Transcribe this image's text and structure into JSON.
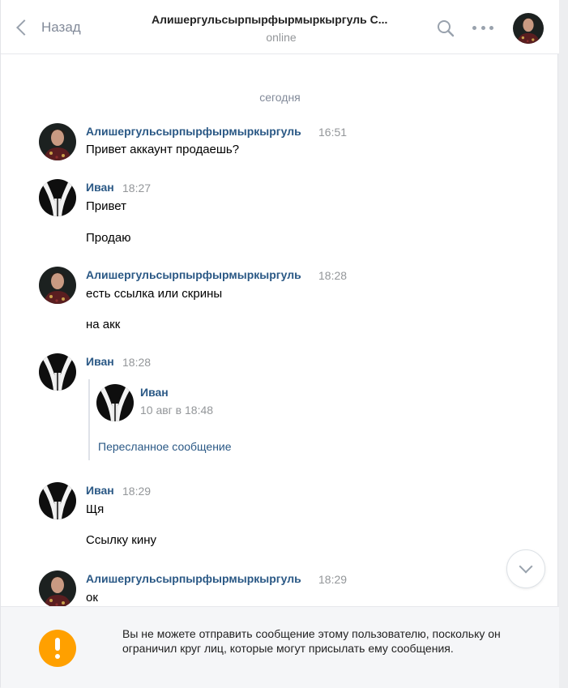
{
  "header": {
    "back_label": "Назад",
    "title": "Алишергульсырпырфырмыркыргуль С...",
    "status": "online"
  },
  "day_label": "сегодня",
  "messages": [
    {
      "author": "Алишергульсырпырфырмыркыргуль",
      "time": "16:51",
      "lines": [
        "Привет аккаунт продаешь?"
      ]
    },
    {
      "author": "Иван",
      "time": "18:27",
      "lines": [
        "Привет",
        "Продаю"
      ]
    },
    {
      "author": "Алишергульсырпырфырмыркыргуль",
      "time": "18:28",
      "lines": [
        "есть ссылка или скрины",
        "на акк"
      ]
    },
    {
      "author": "Иван",
      "time": "18:28",
      "forwarded": {
        "author": "Иван",
        "date": "10 авг в 18:48",
        "link": "Пересланное сообщение"
      }
    },
    {
      "author": "Иван",
      "time": "18:29",
      "lines": [
        "Щя",
        "Ссылку кину"
      ]
    },
    {
      "author": "Алишергульсырпырфырмыркыргуль",
      "time": "18:29",
      "lines": [
        "ок"
      ]
    }
  ],
  "footer": {
    "notice": "Вы не можете отправить сообщение этому пользователю, поскольку он ограничил круг лиц, которые могут присылать ему сообщения."
  },
  "colors": {
    "link": "#2a5885",
    "muted": "#939699",
    "warning": "#ffa000"
  }
}
